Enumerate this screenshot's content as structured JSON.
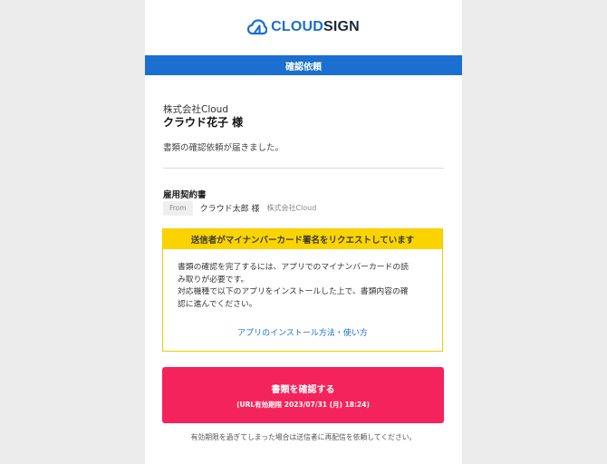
{
  "brand": {
    "logo_cloud": "CLOUD",
    "logo_sign": "SIGN",
    "accent_color": "#1b6fd0",
    "icon": "cloud-logo-icon"
  },
  "banner": {
    "title": "確認依頼"
  },
  "recipient": {
    "company": "株式会社Cloud",
    "name": "クラウド花子 様"
  },
  "message": "書類の確認依頼が届きました。",
  "document": {
    "title": "雇用契約書",
    "from_label": "From",
    "sender_name": "クラウド太郎 様",
    "sender_company": "株式会社Cloud"
  },
  "notice_box": {
    "heading": "送信者がマイナンバーカード署名をリクエストしています",
    "line1": "書類の確認を完了するには、アプリでのマイナンバーカードの読",
    "line2": "み取りが必要です。",
    "line3": "対応機種で以下のアプリをインストールした上で、書類内容の確",
    "line4": "認に進んでください。",
    "link": "アプリのインストール方法・使い方",
    "highlight_color": "#fbd400"
  },
  "cta": {
    "label": "書類を確認する",
    "expiry": "(URL有効期限 2023/07/31 (月) 18:24)",
    "color": "#f5235b"
  },
  "footnote": "有効期限を過ぎてしまった場合は送信者に再配信を依頼してください。"
}
